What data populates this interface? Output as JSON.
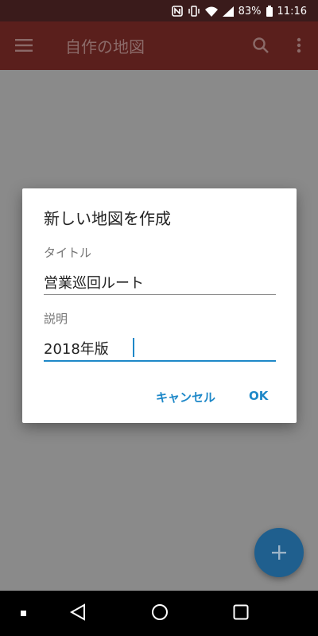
{
  "status_bar": {
    "battery": "83%",
    "time": "11:16",
    "icons": [
      "nfc-icon",
      "vibrate-icon",
      "wifi-icon",
      "signal-icon",
      "battery-icon"
    ]
  },
  "app_bar": {
    "title": "自作の地図",
    "icons": [
      "menu-icon",
      "search-icon",
      "more-vert-icon"
    ]
  },
  "dialog": {
    "title": "新しい地図を作成",
    "title_label": "タイトル",
    "title_value": "営業巡回ルート",
    "description_label": "説明",
    "description_value": "2018年版",
    "cancel_label": "キャンセル",
    "ok_label": "OK"
  },
  "fab": {
    "icon": "plus-icon"
  },
  "nav_bar": {
    "icons": [
      "dot-icon",
      "back-icon",
      "home-icon",
      "recents-icon"
    ]
  },
  "colors": {
    "app_bar": "#5a1f1c",
    "status_bar": "#3a1b1b",
    "accent": "#1e88c8",
    "fab": "#1f5f8e"
  }
}
